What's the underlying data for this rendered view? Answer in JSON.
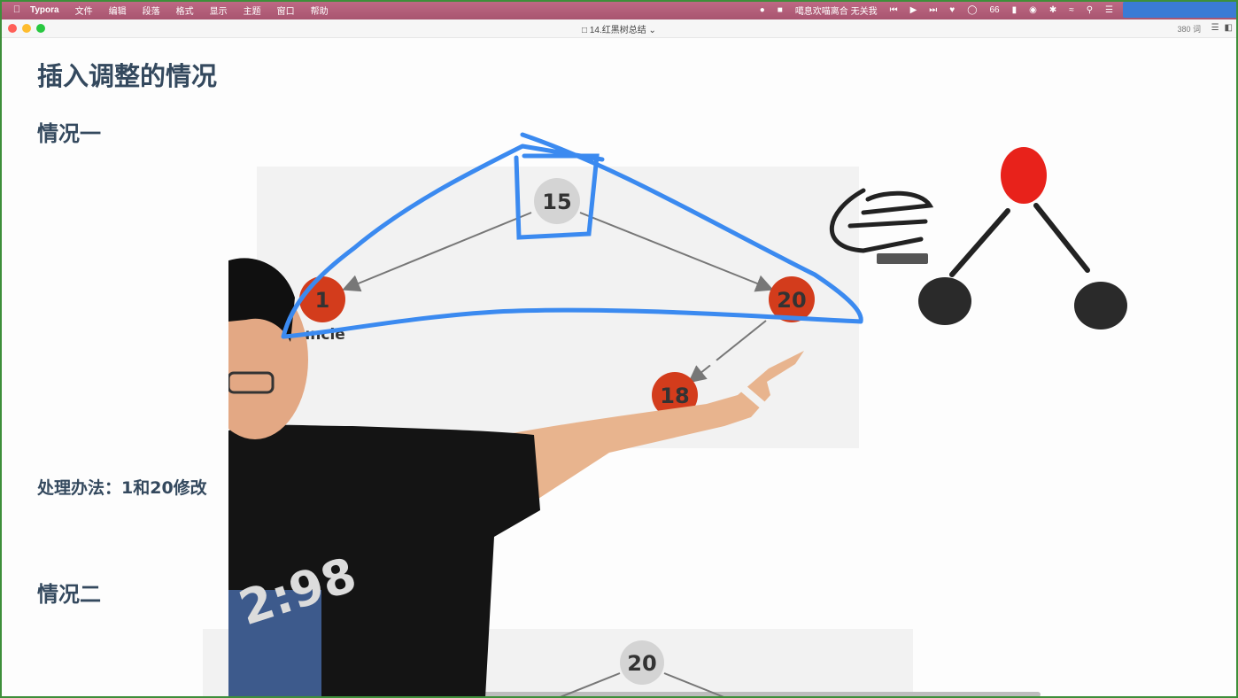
{
  "menubar": {
    "app_name": "Typora",
    "items": [
      "文件",
      "编辑",
      "段落",
      "格式",
      "显示",
      "主题",
      "窗口",
      "帮助"
    ],
    "now_playing": "噶息欢喵离合 无关我",
    "battery_value": "66"
  },
  "window": {
    "title": "14.红黑树总结",
    "word_count": "380 词"
  },
  "document": {
    "heading": "插入调整的情况",
    "case1_title": "情况一",
    "case1_method": "处理办法：1和20修改",
    "case2_title": "情况二"
  },
  "diagram1": {
    "nodes": [
      {
        "label": "15",
        "color": "gray"
      },
      {
        "label": "1",
        "color": "red",
        "tag": "uncle"
      },
      {
        "label": "20",
        "color": "red"
      },
      {
        "label": "18",
        "color": "red"
      }
    ]
  },
  "diagram2": {
    "nodes": [
      {
        "label": "20",
        "color": "gray"
      }
    ]
  },
  "colors": {
    "node_red": "#d33c1c",
    "node_gray": "#d4d4d4",
    "ink_blue": "#3b8af0",
    "ink_black": "#222222",
    "ink_red": "#e8221b",
    "heading_text": "#34495e"
  }
}
